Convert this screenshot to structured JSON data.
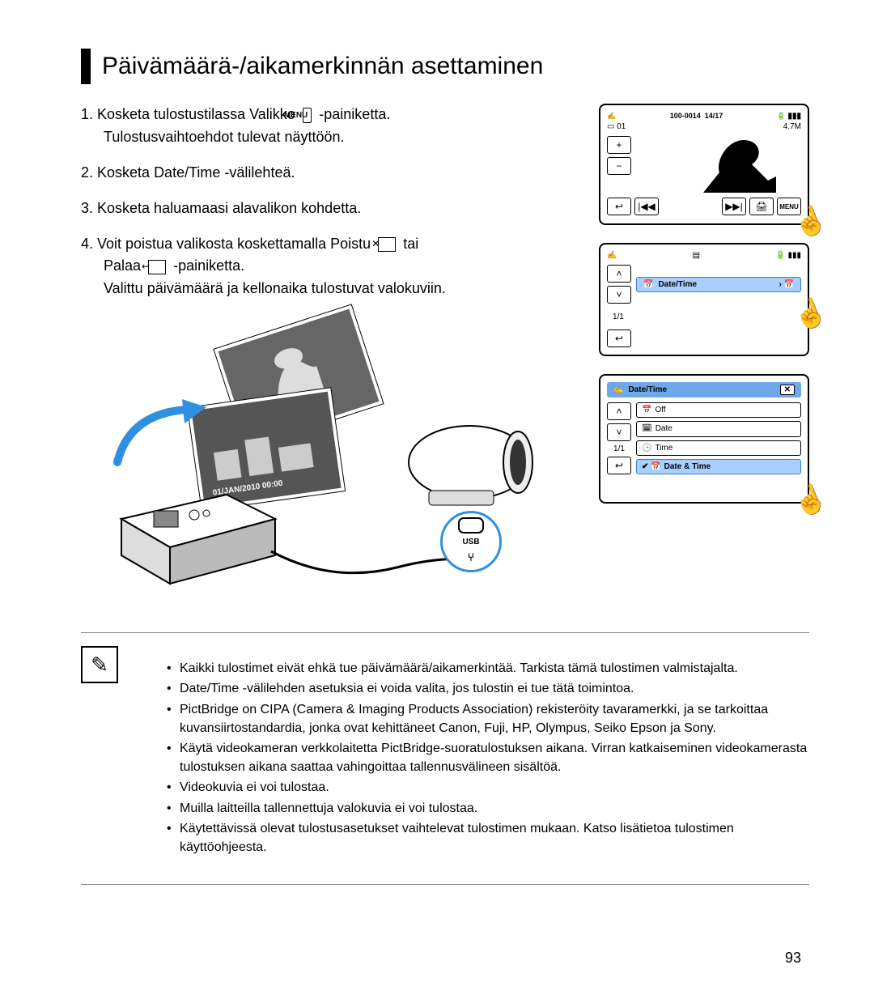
{
  "title": "Päivämäärä-/aikamerkinnän asettaminen",
  "steps": {
    "s1a": "1. Kosketa tulostustilassa Valikko",
    "s1b": "-painiketta.",
    "s1c": "Tulostusvaihtoehdot tulevat näyttöön.",
    "s2a": "2. Kosketa ",
    "s2b": "Date/Time",
    "s2c": " -välilehteä.",
    "s3": "3. Kosketa haluamaasi alavalikon kohdetta.",
    "s4a": "4. Voit poistua valikosta koskettamalla Poistu",
    "s4b": "tai",
    "s4c": "Palaa",
    "s4d": "-painiketta.",
    "s4e": "Valittu päivämäärä ja kellonaika tulostuvat valokuviin."
  },
  "menu_chip": "MENU",
  "icon_close": "✕",
  "icon_return": "↩",
  "screens": {
    "s1": {
      "top_code": "100-0014",
      "count": "14/17",
      "res": "4.7M",
      "thumb": "01",
      "plus": "+",
      "minus": "−",
      "back": "↩",
      "prev": "|◀◀",
      "next": "▶▶|",
      "print": "🖨",
      "menu": "MENU"
    },
    "s2": {
      "row_label": "Date/Time",
      "page": "1/1",
      "up": "˄",
      "down": "˅",
      "back": "↩"
    },
    "s3": {
      "title": "Date/Time",
      "close": "✕",
      "page": "1/1",
      "up": "˄",
      "down": "˅",
      "back": "↩",
      "off": "Off",
      "date": "Date",
      "time": "Time",
      "datetime": "Date & Time"
    }
  },
  "diagram": {
    "date_stamp": "01/JAN/2010 00:00",
    "usb_label": "USB"
  },
  "notes": [
    "Kaikki tulostimet eivät ehkä tue päivämäärä/aikamerkintää. Tarkista tämä tulostimen valmistajalta.",
    "Date/Time -välilehden asetuksia ei voida valita, jos tulostin ei tue tätä toimintoa.",
    "PictBridge on CIPA (Camera & Imaging Products Association) rekisteröity tavaramerkki, ja se tarkoittaa kuvansiirtostandardia, jonka ovat kehittäneet Canon, Fuji, HP, Olympus, Seiko Epson ja Sony.",
    "Käytä videokameran verkkolaitetta PictBridge-suoratulostuksen aikana. Virran katkaiseminen videokamerasta tulostuksen aikana saattaa vahingoittaa tallennusvälineen sisältöä.",
    "Videokuvia ei voi tulostaa.",
    "Muilla laitteilla tallennettuja valokuvia ei voi tulostaa.",
    "Käytettävissä olevat tulostusasetukset vaihtelevat tulostimen mukaan. Katso lisätietoa tulostimen käyttöohjeesta."
  ],
  "page_number": "93"
}
